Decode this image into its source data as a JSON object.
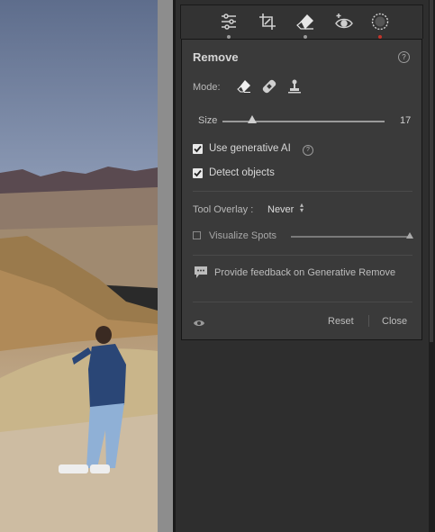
{
  "toolbar": {
    "tools": [
      {
        "icon": "edit-sliders-icon",
        "active_dot": "grey"
      },
      {
        "icon": "crop-icon",
        "active_dot": "none"
      },
      {
        "icon": "eraser-icon",
        "active_dot": "grey"
      },
      {
        "icon": "red-eye-icon",
        "active_dot": "none"
      },
      {
        "icon": "masking-icon",
        "active_dot": "red"
      }
    ]
  },
  "remove_panel": {
    "title": "Remove",
    "mode_label": "Mode:",
    "mode_tools": [
      "eraser-icon",
      "heal-bandage-icon",
      "clone-stamp-icon"
    ],
    "size_label": "Size",
    "size_value": "17",
    "size_fraction": 0.18,
    "use_generative_ai": {
      "label": "Use generative AI",
      "checked": true
    },
    "detect_objects": {
      "label": "Detect objects",
      "checked": true
    },
    "tool_overlay_label": "Tool Overlay :",
    "tool_overlay_value": "Never",
    "visualize_spots": {
      "label": "Visualize Spots",
      "checked": false,
      "level": 1.0
    },
    "feedback_label": "Provide feedback on Generative Remove",
    "reset_label": "Reset",
    "close_label": "Close"
  },
  "colors": {
    "panel_bg": "#3a3a3a",
    "active_dot": "#c2352b",
    "checkbox": "#e8e8e8"
  }
}
